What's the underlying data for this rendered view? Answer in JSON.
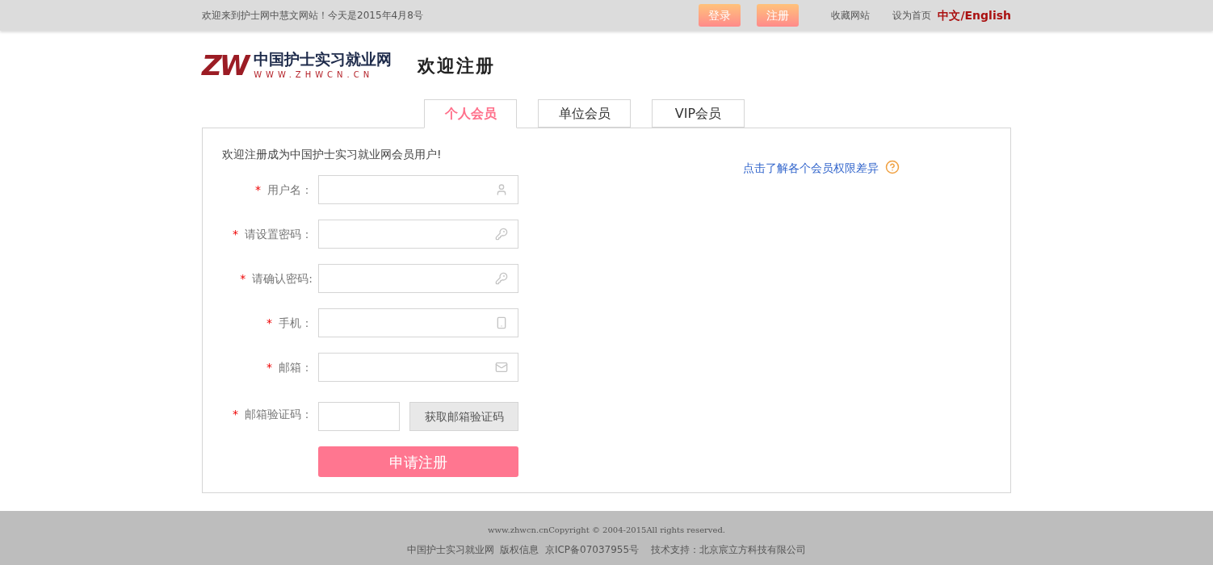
{
  "top_bar": {
    "welcome": "欢迎来到护士网中慧文网站！今天是2015年4月8号",
    "login": "登录",
    "register": "注册",
    "favorite": "收藏网站",
    "homepage": "设为首页",
    "language": "中文/English"
  },
  "header": {
    "logo_mark": "ZW",
    "logo_title": "中国护士实习就业网",
    "logo_url": "WWW.ZHWCN.CN",
    "page_title": "欢迎注册"
  },
  "tabs": [
    {
      "label": "个人会员",
      "selected": true
    },
    {
      "label": "单位会员",
      "selected": false
    },
    {
      "label": "VIP会员",
      "selected": false
    }
  ],
  "form": {
    "intro": "欢迎注册成为中国护士实习就业网会员用户!",
    "help_link": "点击了解各个会员权限差异",
    "fields": [
      {
        "kind": "username",
        "required": true,
        "label": "用户名："
      },
      {
        "kind": "password",
        "required": true,
        "label": "请设置密码："
      },
      {
        "kind": "password",
        "required": true,
        "label": "请确认密码:"
      },
      {
        "kind": "phone",
        "required": true,
        "label": "手机："
      },
      {
        "kind": "email",
        "required": true,
        "label": "邮箱："
      },
      {
        "kind": "code",
        "required": true,
        "label": "邮箱验证码：",
        "button": "获取邮箱验证码"
      }
    ],
    "required_mark": "*",
    "submit": "申请注册"
  },
  "footer": {
    "copyright": "www.zhwcn.cnCopyright © 2004-2015All rights reserved.",
    "info": "中国护士实习就业网  版权信息  京ICP备07037955号    技术支持：北京宸立方科技有限公司"
  }
}
